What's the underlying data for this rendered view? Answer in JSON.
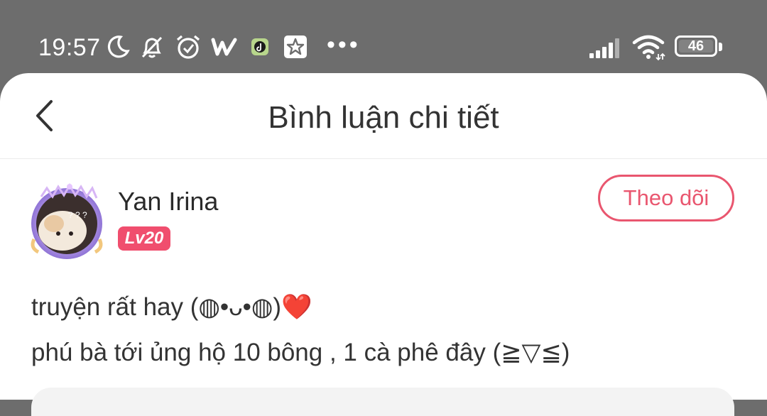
{
  "status_bar": {
    "time": "19:57",
    "battery": "46",
    "icons": [
      "moon-icon",
      "bell-off-icon",
      "alarm-icon",
      "w-app-icon",
      "tiktok-icon",
      "star-app-icon",
      "more-dots-icon",
      "signal-icon",
      "wifi-icon",
      "battery-icon"
    ],
    "more": "•••"
  },
  "header": {
    "title": "Bình luận chi tiết",
    "back_icon": "chevron-left-icon"
  },
  "comment": {
    "username": "Yan Irina",
    "level": "Lv20",
    "follow_label": "Theo dõi",
    "line1_text": "truyện rất hay (◍•ᴗ•◍)",
    "line1_emoji": "❤️",
    "line2_text": "phú bà tới ủng hộ 10 bông ,  1 cà phê đây (≧▽≦)"
  },
  "colors": {
    "accent": "#e9566f",
    "level_badge": "#f04e6e",
    "status_bg": "#6d6d6d"
  }
}
